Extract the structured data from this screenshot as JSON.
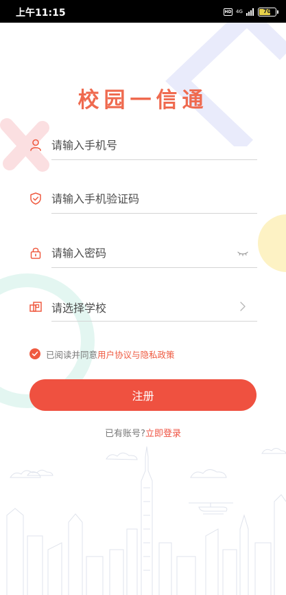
{
  "status_bar": {
    "time": "上午11:15",
    "hd": "HD",
    "network": "4G",
    "battery": "70",
    "battery_percent": 70
  },
  "app": {
    "title": "校园一信通"
  },
  "form": {
    "phone": {
      "placeholder": "请输入手机号",
      "icon": "user-icon"
    },
    "code": {
      "placeholder": "请输入手机验证码",
      "icon": "shield-check-icon"
    },
    "password": {
      "placeholder": "请输入密码",
      "icon": "lock-icon",
      "trail_icon": "eye-closed-icon"
    },
    "school": {
      "label": "请选择学校",
      "icon": "school-icon",
      "trail_icon": "chevron-right-icon"
    }
  },
  "agreement": {
    "prefix": "已阅读并同意",
    "link": "用户协议与隐私政策",
    "checked": true
  },
  "register_button": "注册",
  "login": {
    "prefix": "已有账号?",
    "link": "立即登录"
  },
  "colors": {
    "accent": "#ef5140",
    "title": "#ef6a4f"
  }
}
